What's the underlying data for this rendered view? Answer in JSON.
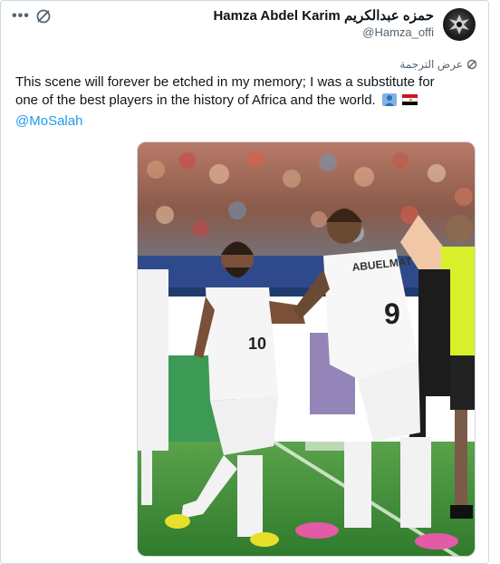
{
  "post": {
    "author": {
      "display_name": "Hamza Abdel Karim حمزه عبدالكريم",
      "handle": "@Hamza_offi"
    },
    "translate_label": "عرض الترجمة",
    "text": "This scene will forever be etched in my memory; I was a substitute for one of the best players in the history of Africa and the world.",
    "emojis": [
      "person-emoji",
      "egypt-flag-emoji"
    ],
    "mention": "@MoSalah",
    "photo": {
      "player_left_number": "10",
      "player_right_name": "ABUELMAT",
      "player_right_number": "9"
    }
  },
  "icons": [
    "more-icon",
    "grok-icon",
    "translate-icon"
  ],
  "colors": {
    "link": "#1d9bf0",
    "text": "#0f1419",
    "muted": "#536471",
    "border": "#cfd9de",
    "pitch": "#3f8f36",
    "crowd": "#8a5a4a",
    "referee_yellow": "#d8f02a"
  }
}
